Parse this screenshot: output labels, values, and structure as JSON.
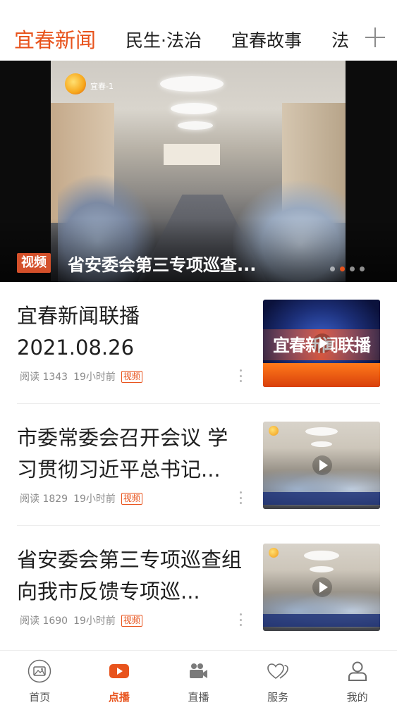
{
  "colors": {
    "accent": "#e8531c",
    "badge": "#d4502a",
    "text": "#1f1f1f",
    "meta": "#8a8a8a"
  },
  "tabs": [
    {
      "label": "宜春新闻",
      "active": true
    },
    {
      "label": "民生·法治",
      "active": false
    },
    {
      "label": "宜春故事",
      "active": false
    },
    {
      "label": "法",
      "active": false
    }
  ],
  "add_channel_icon": "plus-icon",
  "hero": {
    "badge": "视频",
    "title": "省安委会第三专项巡查...",
    "channel_logo_text": "宜春-1",
    "dots": {
      "count": 4,
      "active_index": 1
    }
  },
  "news": [
    {
      "title": "宜春新闻联播 2021.08.26",
      "reads": "阅读 1343",
      "time": "19小时前",
      "tag": "视频",
      "thumb_caption": "宜春新闻联播"
    },
    {
      "title": "市委常委会召开会议 学习贯彻习近平总书记...",
      "reads": "阅读 1829",
      "time": "19小时前",
      "tag": "视频",
      "thumb_caption": ""
    },
    {
      "title": "省安委会第三专项巡查组向我市反馈专项巡...",
      "reads": "阅读 1690",
      "time": "19小时前",
      "tag": "视频",
      "thumb_caption": ""
    }
  ],
  "bottom_nav": [
    {
      "label": "首页",
      "icon": "home-picture-icon",
      "active": false
    },
    {
      "label": "点播",
      "icon": "play-icon",
      "active": true
    },
    {
      "label": "直播",
      "icon": "video-camera-icon",
      "active": false
    },
    {
      "label": "服务",
      "icon": "hearts-icon",
      "active": false
    },
    {
      "label": "我的",
      "icon": "user-icon",
      "active": false
    }
  ]
}
